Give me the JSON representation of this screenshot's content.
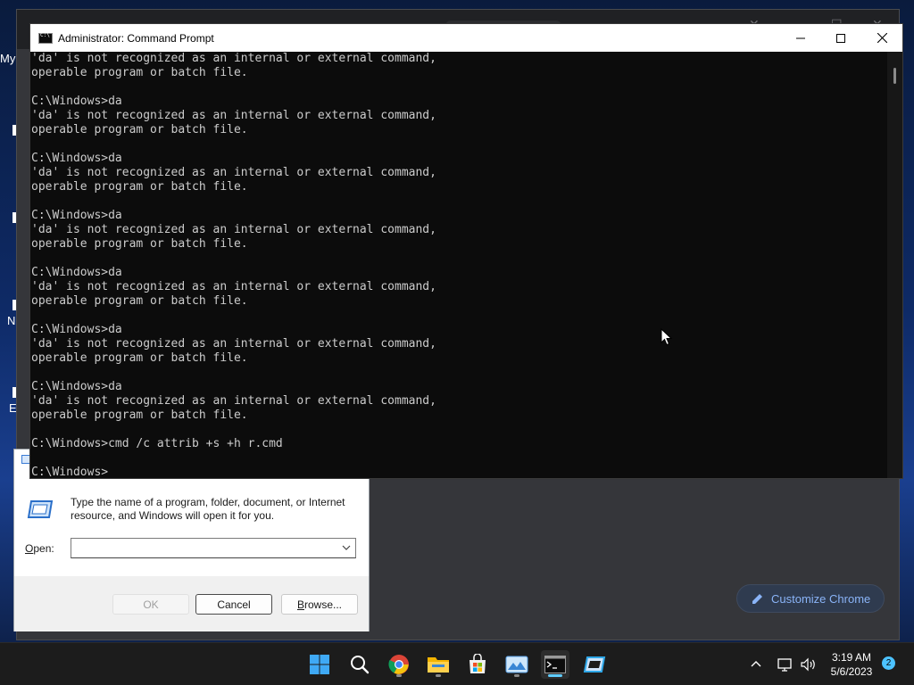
{
  "desktop": {
    "fragments": [
      "My",
      "N",
      "E"
    ]
  },
  "chrome": {
    "customize_label": "Customize Chrome"
  },
  "cmd": {
    "title": "Administrator: Command Prompt",
    "lines": [
      "'da' is not recognized as an internal or external command,",
      "operable program or batch file.",
      "",
      "C:\\Windows>da",
      "'da' is not recognized as an internal or external command,",
      "operable program or batch file.",
      "",
      "C:\\Windows>da",
      "'da' is not recognized as an internal or external command,",
      "operable program or batch file.",
      "",
      "C:\\Windows>da",
      "'da' is not recognized as an internal or external command,",
      "operable program or batch file.",
      "",
      "C:\\Windows>da",
      "'da' is not recognized as an internal or external command,",
      "operable program or batch file.",
      "",
      "C:\\Windows>da",
      "'da' is not recognized as an internal or external command,",
      "operable program or batch file.",
      "",
      "C:\\Windows>da",
      "'da' is not recognized as an internal or external command,",
      "operable program or batch file.",
      "",
      "C:\\Windows>cmd /c attrib +s +h r.cmd",
      "",
      "C:\\Windows>"
    ]
  },
  "run": {
    "description": "Type the name of a program, folder, document, or Internet resource, and Windows will open it for you.",
    "open_label_prefix": "",
    "open_label_underlined": "O",
    "open_label_rest": "pen:",
    "open_value": "",
    "ok_label": "OK",
    "cancel_label": "Cancel",
    "browse_label_underlined": "B",
    "browse_label_rest": "rowse..."
  },
  "taskbar": {
    "apps": [
      "start-icon",
      "search-icon",
      "chrome-icon",
      "file-explorer-icon",
      "microsoft-store-icon",
      "photos-icon",
      "command-prompt-icon",
      "run-icon"
    ],
    "active_app": "command-prompt-icon",
    "time": "3:19 AM",
    "date": "5/6/2023",
    "notification_count": "2"
  },
  "colors": {
    "accent": "#60cdff",
    "chrome_link": "#8ab4f8",
    "cmd_text": "#cccccc"
  }
}
